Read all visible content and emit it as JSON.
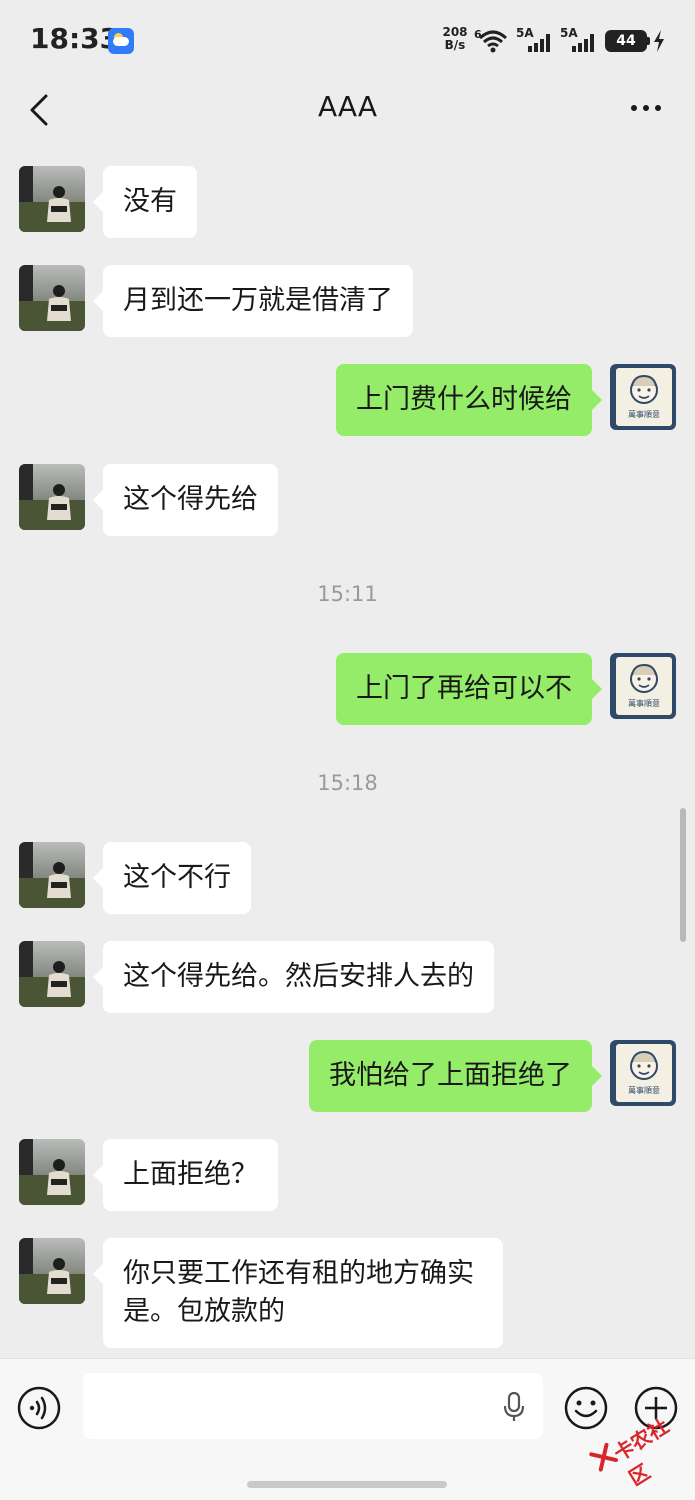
{
  "status_bar": {
    "time": "18:33",
    "net_speed_value": "208",
    "net_speed_unit": "B/s",
    "wifi_label": "6",
    "signal_1_label": "5A",
    "signal_2_label": "5A",
    "battery": "44"
  },
  "header": {
    "title": "AAA"
  },
  "messages": [
    {
      "side": "left",
      "text": "没有"
    },
    {
      "side": "left",
      "text": "月到还一万就是借清了"
    },
    {
      "side": "right",
      "text": "上门费什么时候给"
    },
    {
      "side": "left",
      "text": "这个得先给"
    },
    {
      "type": "time",
      "text": "15:11"
    },
    {
      "side": "right",
      "text": "上门了再给可以不"
    },
    {
      "type": "time",
      "text": "15:18"
    },
    {
      "side": "left",
      "text": "这个不行"
    },
    {
      "side": "left",
      "text": "这个得先给。然后安排人去的"
    },
    {
      "side": "right",
      "text": "我怕给了上面拒绝了"
    },
    {
      "side": "left",
      "text": "上面拒绝？"
    },
    {
      "side": "left",
      "text": "你只要工作还有租的地方确实是。包放款的"
    }
  ],
  "self_avatar_caption": "萬事順意",
  "input": {
    "placeholder": ""
  },
  "watermark": "卡农社区",
  "colors": {
    "background": "#ededed",
    "own_bubble": "#95ec69",
    "other_bubble": "#ffffff",
    "timestamp": "#9a9a9a"
  },
  "icons": [
    "back-icon",
    "more-icon",
    "voice-icon",
    "mic-icon",
    "emoji-icon",
    "plus-icon"
  ]
}
